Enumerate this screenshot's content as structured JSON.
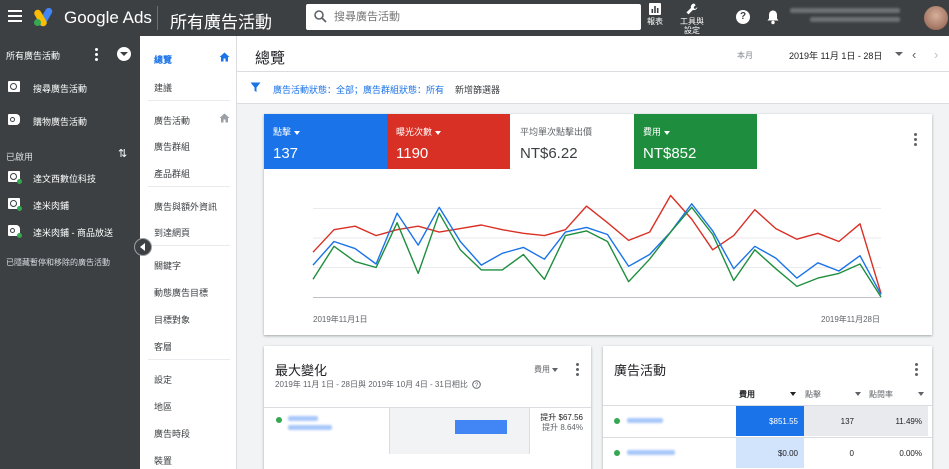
{
  "topbar": {
    "brand": "Google Ads",
    "page_heading": "所有廣告活動",
    "search_placeholder": "搜尋廣告活動",
    "reports_label": "報表",
    "tools_label_1": "工具與",
    "tools_label_2": "設定",
    "help_glyph": "?",
    "colors": {
      "bar": "#3c4043"
    }
  },
  "sidebar": {
    "title": "所有廣告活動",
    "campaign_types": [
      {
        "label": "搜尋廣告活動",
        "icon": "search-campaign-icon"
      },
      {
        "label": "購物廣告活動",
        "icon": "shopping-tag-icon"
      }
    ],
    "enabled_section": "已啟用",
    "sort_glyph": "⇅",
    "campaigns": [
      {
        "label": "達文西數位科技",
        "icon": "search-campaign-icon"
      },
      {
        "label": "達米肉鋪",
        "icon": "search-campaign-icon"
      },
      {
        "label": "達米肉鋪 - 商品放送",
        "icon": "shopping-tag-icon"
      }
    ],
    "footer": "已隱藏暫停和移除的廣告活動"
  },
  "pagenav": {
    "items": [
      {
        "label": "總覽",
        "active": true
      },
      {
        "label": "建議"
      },
      {
        "label": "廣告活動"
      },
      {
        "label": "廣告群組"
      },
      {
        "label": "產品群組"
      },
      {
        "label": "廣告與額外資訊"
      },
      {
        "label": "到達網頁"
      },
      {
        "label": "關鍵字"
      },
      {
        "label": "動態廣告目標"
      },
      {
        "label": "目標對象"
      },
      {
        "label": "客層"
      },
      {
        "label": "設定"
      },
      {
        "label": "地區"
      },
      {
        "label": "廣告時段"
      },
      {
        "label": "裝置"
      }
    ]
  },
  "main": {
    "title": "總覽",
    "period_label": "本月",
    "date_range": "2019年 11月 1日 - 28日",
    "prev_glyph": "‹",
    "next_glyph": "›"
  },
  "filters": {
    "active_filter": "廣告活動狀態：全部；廣告群組狀態：所有",
    "add_filter": "新增篩選器"
  },
  "performance": {
    "metrics": [
      {
        "name": "點擊",
        "value": "137",
        "color": "#1a73e8",
        "selected": true
      },
      {
        "name": "曝光次數",
        "value": "1190",
        "color": "#d93025",
        "selected": true
      },
      {
        "name": "平均單次點擊出價",
        "value": "NT$6.22",
        "color": "#ffffff",
        "selected": false
      },
      {
        "name": "費用",
        "value": "NT$852",
        "color": "#1e8e3e",
        "selected": true
      }
    ],
    "x_start_label": "2019年11月1日",
    "x_end_label": "2019年11月28日"
  },
  "chart_data": {
    "type": "line",
    "x": [
      "2019-11-01",
      "2019-11-02",
      "2019-11-03",
      "2019-11-04",
      "2019-11-05",
      "2019-11-06",
      "2019-11-07",
      "2019-11-08",
      "2019-11-09",
      "2019-11-10",
      "2019-11-11",
      "2019-11-12",
      "2019-11-13",
      "2019-11-14",
      "2019-11-15",
      "2019-11-16",
      "2019-11-17",
      "2019-11-18",
      "2019-11-19",
      "2019-11-20",
      "2019-11-21",
      "2019-11-22",
      "2019-11-23",
      "2019-11-24",
      "2019-11-25",
      "2019-11-26",
      "2019-11-27",
      "2019-11-28"
    ],
    "y_range": [
      0,
      100
    ],
    "grid": true,
    "series": [
      {
        "color": "#d93025",
        "values": [
          38,
          57,
          60,
          52,
          57,
          60,
          55,
          58,
          61,
          57,
          54,
          52,
          57,
          77,
          63,
          48,
          55,
          86,
          66,
          40,
          52,
          74,
          58,
          49,
          54,
          47,
          62,
          3
        ]
      },
      {
        "color": "#1a73e8",
        "values": [
          27,
          47,
          41,
          28,
          71,
          44,
          76,
          47,
          27,
          37,
          42,
          32,
          55,
          59,
          53,
          26,
          36,
          55,
          79,
          56,
          24,
          43,
          33,
          16,
          29,
          22,
          35,
          2
        ]
      },
      {
        "color": "#1e8e3e",
        "values": [
          15,
          43,
          30,
          25,
          63,
          20,
          71,
          40,
          23,
          23,
          36,
          15,
          52,
          56,
          47,
          13,
          32,
          55,
          76,
          53,
          14,
          40,
          24,
          9,
          16,
          20,
          28,
          0
        ]
      }
    ]
  },
  "biggest_changes": {
    "title": "最大變化",
    "subtitle": "2019年 11月 1日 - 28日與 2019年 10月 4日 - 31日相比",
    "metric_selector": "費用",
    "row": {
      "change_value": "提升 $67.56",
      "change_pct": "提升 8.64%",
      "bar_fraction": 0.95
    }
  },
  "campaigns": {
    "title": "廣告活動",
    "columns": [
      "費用",
      "點擊",
      "點閱率"
    ],
    "rows": [
      {
        "cost": "$851.55",
        "clicks": "137",
        "ctr": "11.49%"
      },
      {
        "cost": "$0.00",
        "clicks": "0",
        "ctr": "0.00%"
      }
    ]
  }
}
